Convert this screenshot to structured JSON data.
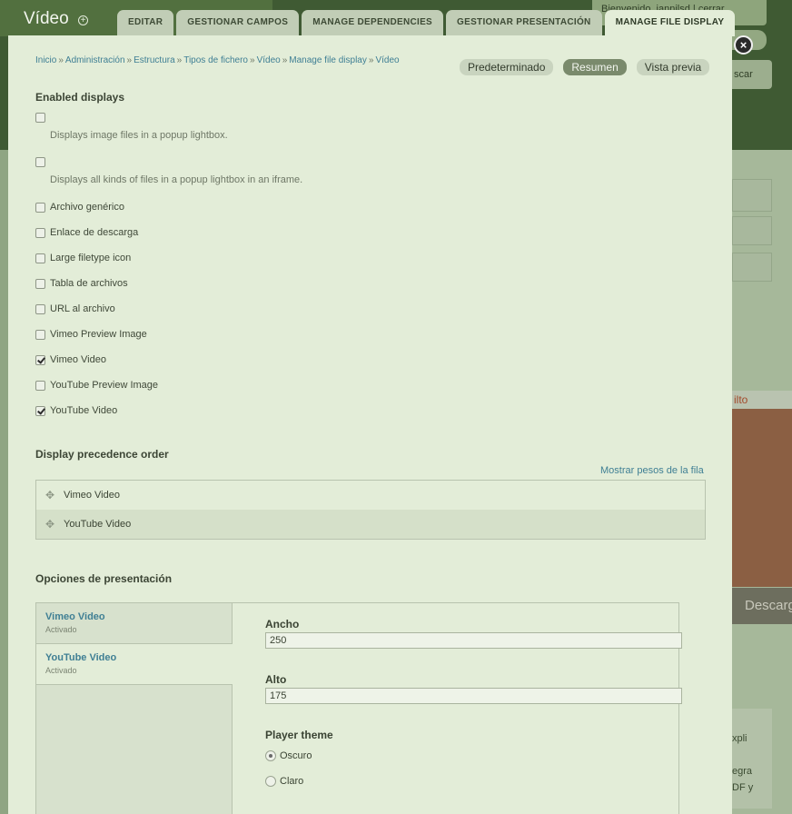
{
  "app": {
    "title": "Vídeo",
    "add_shortcut_symbol": "+"
  },
  "tabs": [
    {
      "label": "EDITAR",
      "active": false
    },
    {
      "label": "GESTIONAR CAMPOS",
      "active": false
    },
    {
      "label": "MANAGE DEPENDENCIES",
      "active": false
    },
    {
      "label": "GESTIONAR PRESENTACIÓN",
      "active": false
    },
    {
      "label": "MANAGE FILE DISPLAY",
      "active": true
    }
  ],
  "background": {
    "welcome_text": "Bienvenido, jannilsd | cerrar",
    "search_label": "scar",
    "orange_header": "ilto",
    "download_label": "Descarg",
    "text_lines": [
      "xpli",
      "egra",
      "DF y"
    ]
  },
  "breadcrumb": [
    {
      "label": "Inicio"
    },
    {
      "label": "Administración"
    },
    {
      "label": "Estructura"
    },
    {
      "label": "Tipos de fichero"
    },
    {
      "label": "Vídeo"
    },
    {
      "label": "Manage file display"
    },
    {
      "label": "Vídeo"
    }
  ],
  "breadcrumb_separator": "»",
  "view_modes": [
    {
      "label": "Predeterminado",
      "active": false
    },
    {
      "label": "Resumen",
      "active": true
    },
    {
      "label": "Vista previa",
      "active": false
    }
  ],
  "enabled_displays": {
    "title": "Enabled displays",
    "items": [
      {
        "label": "",
        "description": "Displays image files in a popup lightbox.",
        "checked": false
      },
      {
        "label": "",
        "description": "Displays all kinds of files in a popup lightbox in an iframe.",
        "checked": false
      },
      {
        "label": "Archivo genérico",
        "description": "",
        "checked": false
      },
      {
        "label": "Enlace de descarga",
        "description": "",
        "checked": false
      },
      {
        "label": "Large filetype icon",
        "description": "",
        "checked": false
      },
      {
        "label": "Tabla de archivos",
        "description": "",
        "checked": false
      },
      {
        "label": "URL al archivo",
        "description": "",
        "checked": false
      },
      {
        "label": "Vimeo Preview Image",
        "description": "",
        "checked": false
      },
      {
        "label": "Vimeo Video",
        "description": "",
        "checked": true
      },
      {
        "label": "YouTube Preview Image",
        "description": "",
        "checked": false
      },
      {
        "label": "YouTube Video",
        "description": "",
        "checked": true
      }
    ]
  },
  "precedence": {
    "title": "Display precedence order",
    "show_weights_link": "Mostrar pesos de la fila",
    "rows": [
      "Vimeo Video",
      "YouTube Video"
    ]
  },
  "display_options": {
    "title": "Opciones de presentación",
    "vertical_tabs": [
      {
        "title": "Vimeo Video",
        "summary": "Activado",
        "selected": false
      },
      {
        "title": "YouTube Video",
        "summary": "Activado",
        "selected": true
      }
    ],
    "width_label": "Ancho",
    "width_value": "250",
    "height_label": "Alto",
    "height_value": "175",
    "theme_label": "Player theme",
    "theme_options": [
      {
        "label": "Oscuro",
        "checked": true
      },
      {
        "label": "Claro",
        "checked": false
      }
    ]
  },
  "close_symbol": "×",
  "drag_symbol": "✥"
}
